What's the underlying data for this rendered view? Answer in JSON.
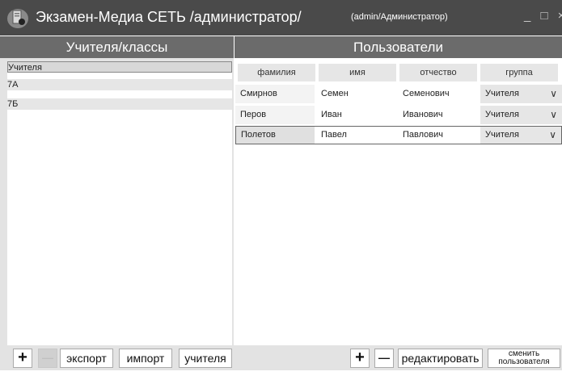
{
  "window": {
    "title": "Экзамен-Медиа СЕТЬ /администратор/",
    "user": "(admin/Администратор)",
    "minimize": "_",
    "maximize": "□",
    "close": "×"
  },
  "left": {
    "header": "Учителя/классы",
    "items": [
      {
        "label": "Учителя"
      },
      {
        "label": "7А"
      },
      {
        "label": "7Б"
      }
    ]
  },
  "right": {
    "header": "Пользователи",
    "columns": [
      "фамилия",
      "имя",
      "отчество",
      "группа"
    ],
    "rows": [
      {
        "last": "Смирнов",
        "first": "Семен",
        "middle": "Семенович",
        "group": "Учителя"
      },
      {
        "last": "Перов",
        "first": "Иван",
        "middle": "Иванович",
        "group": "Учителя"
      },
      {
        "last": "Полетов",
        "first": "Павел",
        "middle": "Павлович",
        "group": "Учителя"
      }
    ]
  },
  "bottom": {
    "add": "+",
    "remove": "—",
    "export": "экспорт",
    "import": "импорт",
    "teachers": "учителя",
    "user_add": "+",
    "user_remove": "—",
    "edit": "редактировать",
    "change_user_1": "сменить",
    "change_user_2": "пользователя"
  },
  "colors": {
    "titlebar": "#4a4a4a",
    "header": "#6b6b6b",
    "panel": "#e3e3e3"
  }
}
